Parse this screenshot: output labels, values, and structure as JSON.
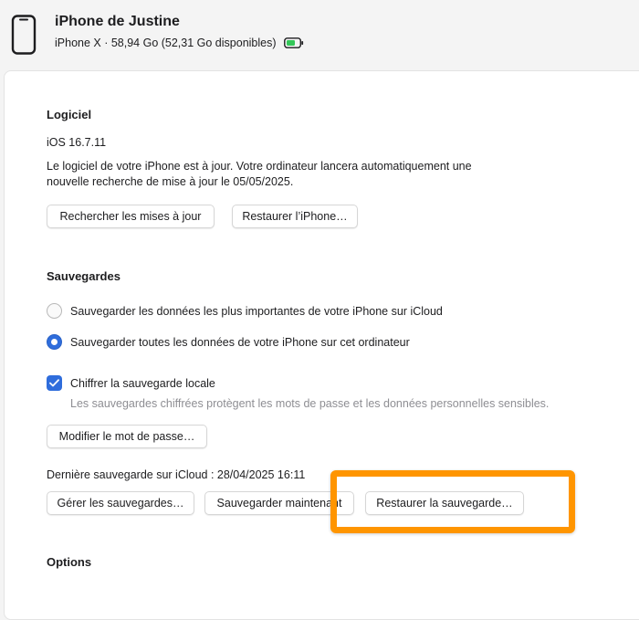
{
  "header": {
    "device_icon": "iphone-icon",
    "device_name": "iPhone de Justine",
    "device_info": "iPhone X · 58,94 Go (52,31 Go disponibles)",
    "battery_icon": "battery-charging-icon",
    "battery_color": "#34c759"
  },
  "software": {
    "title": "Logiciel",
    "version": "iOS 16.7.11",
    "status_line1": "Le logiciel de votre iPhone est à jour. Votre ordinateur lancera automatiquement une",
    "status_line2": "nouvelle recherche de mise à jour le 05/05/2025.",
    "check_updates_label": "Rechercher les mises à jour",
    "restore_iphone_label": "Restaurer l’iPhone…"
  },
  "backups": {
    "title": "Sauvegardes",
    "option_icloud": "Sauvegarder les données les plus importantes de votre iPhone sur iCloud",
    "option_local": "Sauvegarder toutes les données de votre iPhone sur cet ordinateur",
    "selected_option": "local",
    "encrypt_label": "Chiffrer la sauvegarde locale",
    "encrypt_checked": true,
    "encrypt_note": "Les sauvegardes chiffrées protègent les mots de passe et les données personnelles sensibles.",
    "change_password_label": "Modifier le mot de passe…",
    "last_backup": "Dernière sauvegarde sur iCloud : 28/04/2025 16:11",
    "manage_label": "Gérer les sauvegardes…",
    "backup_now_label": "Sauvegarder maintenant",
    "restore_backup_label": "Restaurer la sauvegarde…"
  },
  "options": {
    "title": "Options"
  },
  "colors": {
    "accent": "#2f6ddc",
    "highlight": "#ff9500"
  }
}
